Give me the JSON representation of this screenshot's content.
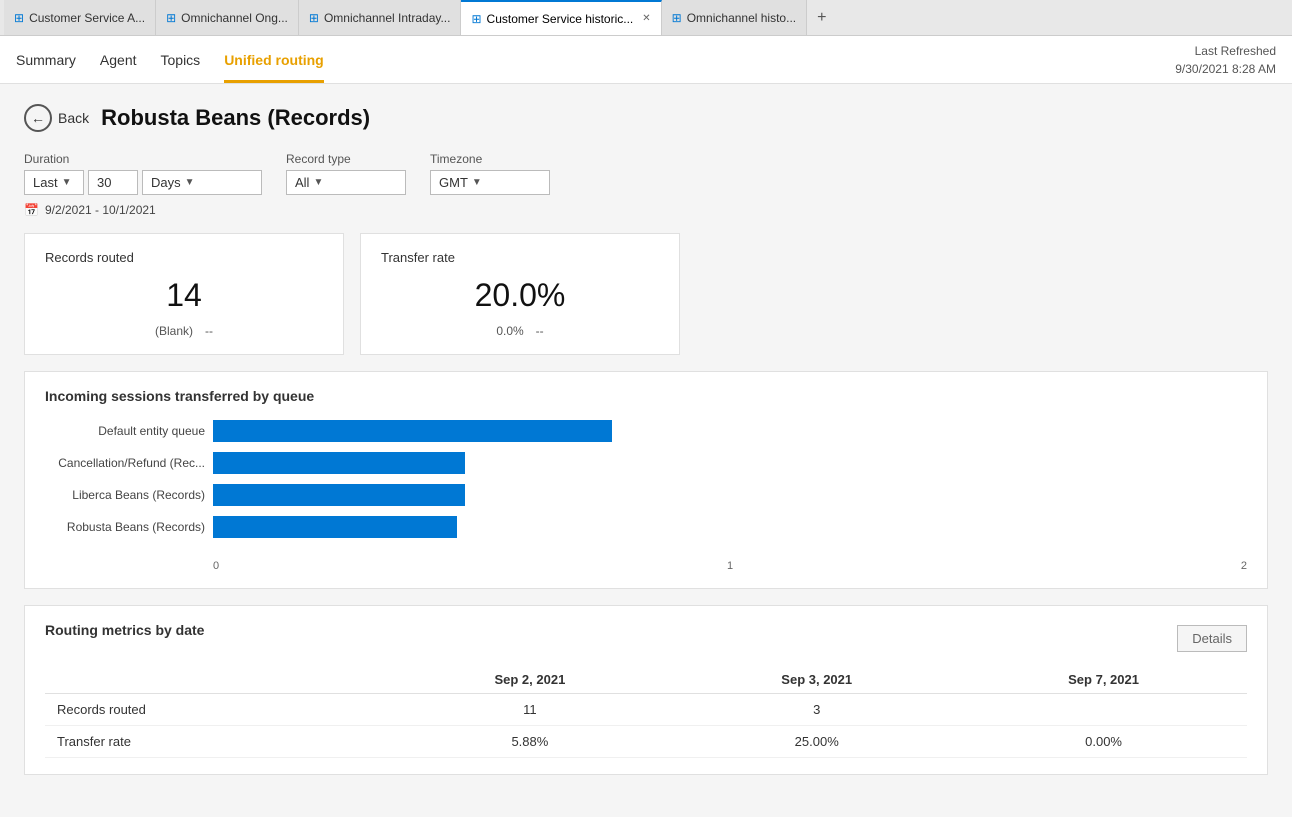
{
  "tabs": [
    {
      "id": "tab1",
      "label": "Customer Service A...",
      "icon": "⊞",
      "active": false,
      "closable": false
    },
    {
      "id": "tab2",
      "label": "Omnichannel Ong...",
      "icon": "⊞",
      "active": false,
      "closable": false
    },
    {
      "id": "tab3",
      "label": "Omnichannel Intraday...",
      "icon": "⊞",
      "active": false,
      "closable": false
    },
    {
      "id": "tab4",
      "label": "Customer Service historic...",
      "icon": "⊞",
      "active": true,
      "closable": true
    },
    {
      "id": "tab5",
      "label": "Omnichannel histo...",
      "icon": "⊞",
      "active": false,
      "closable": false
    }
  ],
  "nav": {
    "links": [
      {
        "label": "Summary",
        "active": false
      },
      {
        "label": "Agent",
        "active": false
      },
      {
        "label": "Topics",
        "active": false
      },
      {
        "label": "Unified routing",
        "active": true
      }
    ],
    "last_refreshed_label": "Last Refreshed",
    "last_refreshed_value": "9/30/2021 8:28 AM"
  },
  "back_label": "Back",
  "page_title": "Robusta Beans (Records)",
  "filters": {
    "duration_label": "Duration",
    "duration_preset": "Last",
    "duration_number": "30",
    "duration_unit": "Days",
    "record_type_label": "Record type",
    "record_type_value": "All",
    "timezone_label": "Timezone",
    "timezone_value": "GMT",
    "date_range": "9/2/2021 - 10/1/2021"
  },
  "records_routed_card": {
    "title": "Records routed",
    "value": "14",
    "footer_label1": "(Blank)",
    "footer_value1": "--"
  },
  "transfer_rate_card": {
    "title": "Transfer rate",
    "value": "20.0%",
    "footer_label1": "0.0%",
    "footer_value1": "--"
  },
  "chart": {
    "title": "Incoming sessions transferred by queue",
    "bars": [
      {
        "label": "Default entity queue",
        "width_pct": 95
      },
      {
        "label": "Cancellation/Refund (Rec...",
        "width_pct": 60
      },
      {
        "label": "Liberca Beans (Records)",
        "width_pct": 60
      },
      {
        "label": "Robusta Beans (Records)",
        "width_pct": 58
      }
    ],
    "axis_labels": [
      "0",
      "1",
      "2"
    ]
  },
  "routing_table": {
    "title": "Routing metrics by date",
    "details_btn": "Details",
    "columns": [
      "",
      "Sep 2, 2021",
      "Sep 3, 2021",
      "Sep 7, 2021"
    ],
    "rows": [
      {
        "label": "Records routed",
        "values": [
          "11",
          "3",
          ""
        ]
      },
      {
        "label": "Transfer rate",
        "values": [
          "5.88%",
          "25.00%",
          "0.00%"
        ]
      }
    ]
  }
}
